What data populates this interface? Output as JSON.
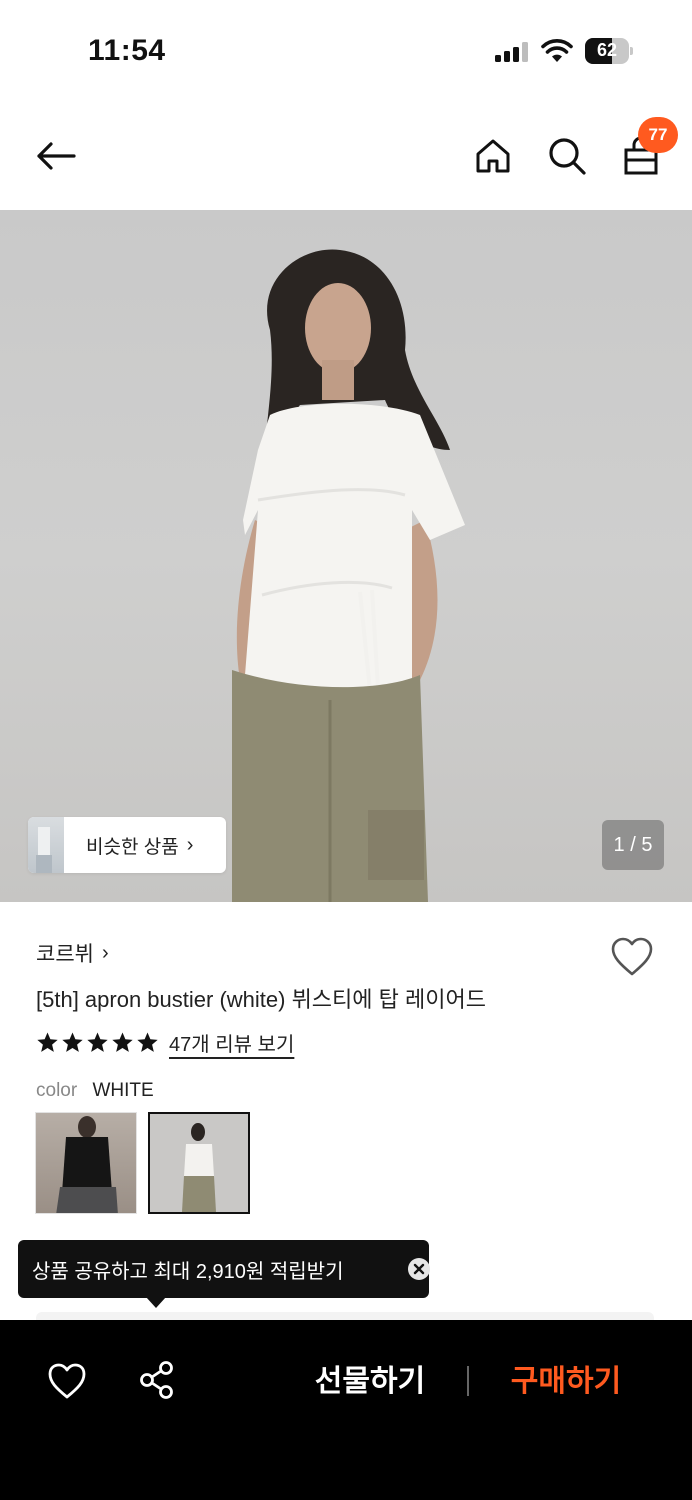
{
  "status_bar": {
    "time": "11:54",
    "battery_percent": "62",
    "battery_level": 0.62
  },
  "nav": {
    "back_icon": "back-arrow-icon",
    "home_icon": "home-icon",
    "search_icon": "search-icon",
    "bag_icon": "shopping-bag-icon",
    "bag_badge": "77",
    "badge_color": "#ff5a1f"
  },
  "gallery": {
    "similar_label": "비슷한 상품",
    "similar_chevron": "›",
    "counter": "1 / 5"
  },
  "product": {
    "brand": "코르뷔",
    "brand_chevron": "›",
    "title": "[5th] apron bustier (white) 뷔스티에 탑 레이어드",
    "rating_stars": 5,
    "review_link": "47개 리뷰 보기",
    "color_key": "color",
    "color_value": "WHITE"
  },
  "tooltip": {
    "text": "상품 공유하고 최대 2,910원 적립받기"
  },
  "bottom_bar": {
    "gift_label": "선물하기",
    "buy_label": "구매하기",
    "buy_color": "#ff5a1f"
  }
}
